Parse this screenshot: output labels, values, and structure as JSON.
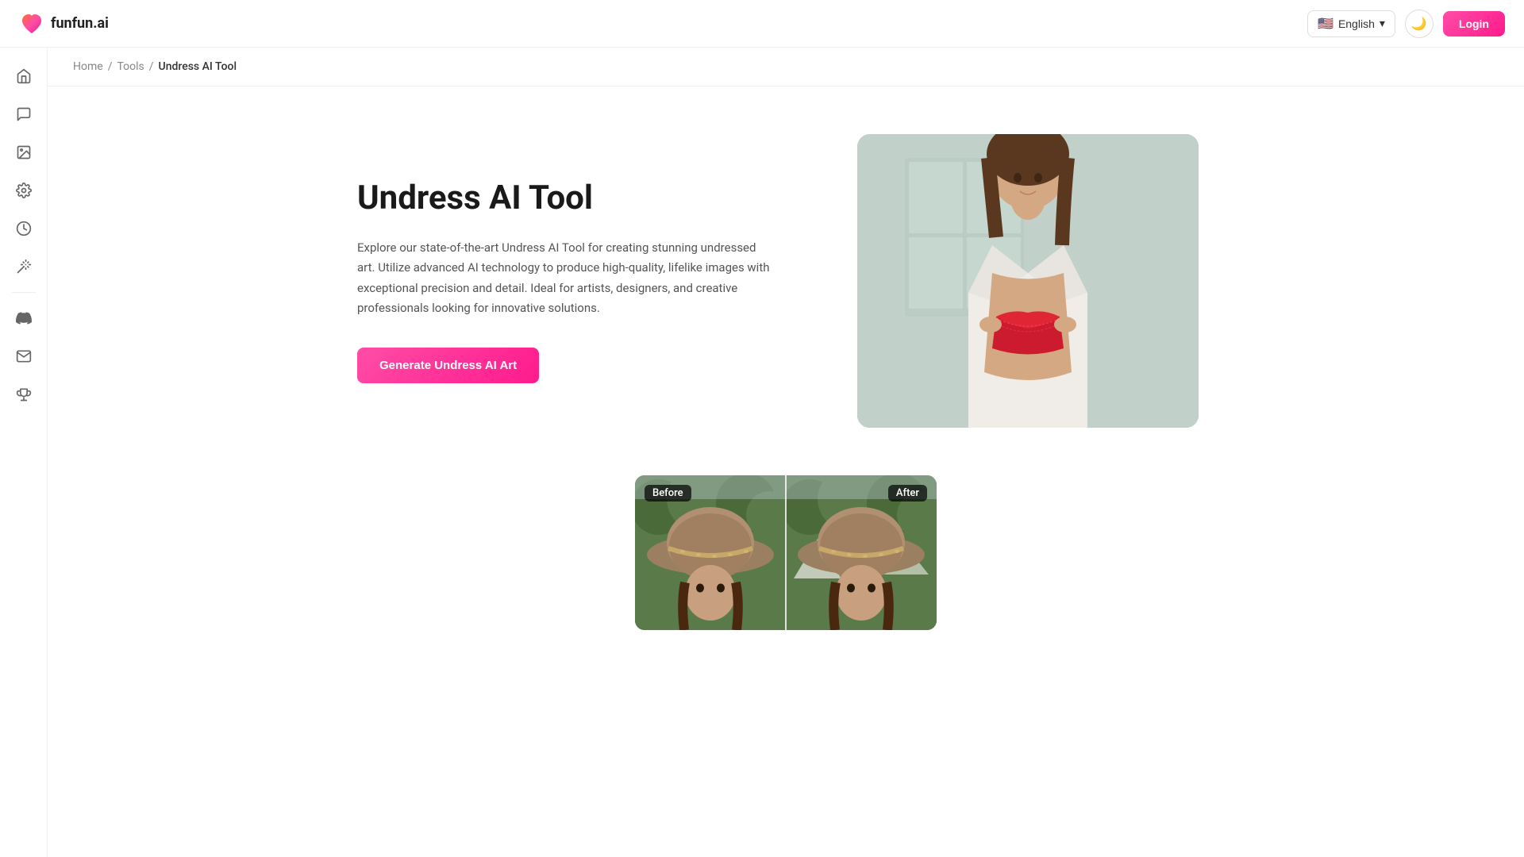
{
  "navbar": {
    "logo_text": "funfun.ai",
    "lang_flag": "🇺🇸",
    "lang_label": "English",
    "lang_chevron": "⌄",
    "dark_toggle_icon": "🌙",
    "login_label": "Login"
  },
  "sidebar": {
    "items": [
      {
        "id": "home",
        "icon": "home",
        "label": "Home",
        "active": false
      },
      {
        "id": "chat",
        "icon": "chat",
        "label": "Chat",
        "active": false
      },
      {
        "id": "image",
        "icon": "image",
        "label": "Image",
        "active": false
      },
      {
        "id": "settings",
        "icon": "settings",
        "label": "Settings",
        "active": false
      },
      {
        "id": "activity",
        "icon": "activity",
        "label": "Activity",
        "active": false
      },
      {
        "id": "magic",
        "icon": "magic",
        "label": "Magic",
        "active": false
      },
      {
        "id": "discord",
        "icon": "discord",
        "label": "Discord",
        "active": false
      },
      {
        "id": "mail",
        "icon": "mail",
        "label": "Mail",
        "active": false
      },
      {
        "id": "trophy",
        "icon": "trophy",
        "label": "Trophy",
        "active": false
      }
    ]
  },
  "breadcrumb": {
    "home": "Home",
    "tools": "Tools",
    "current": "Undress AI Tool",
    "sep": "/"
  },
  "hero": {
    "title": "Undress AI Tool",
    "description": "Explore our state-of-the-art Undress AI Tool for creating stunning undressed art. Utilize advanced AI technology to produce high-quality, lifelike images with exceptional precision and detail. Ideal for artists, designers, and creative professionals looking for innovative solutions.",
    "cta_label": "Generate Undress AI Art"
  },
  "comparison": {
    "before_label": "Before",
    "after_label": "After"
  },
  "colors": {
    "accent": "#ff4da6",
    "accent_dark": "#ff1a8c",
    "text_primary": "#1a1a1a",
    "text_secondary": "#555",
    "border": "#f0f0f0"
  }
}
